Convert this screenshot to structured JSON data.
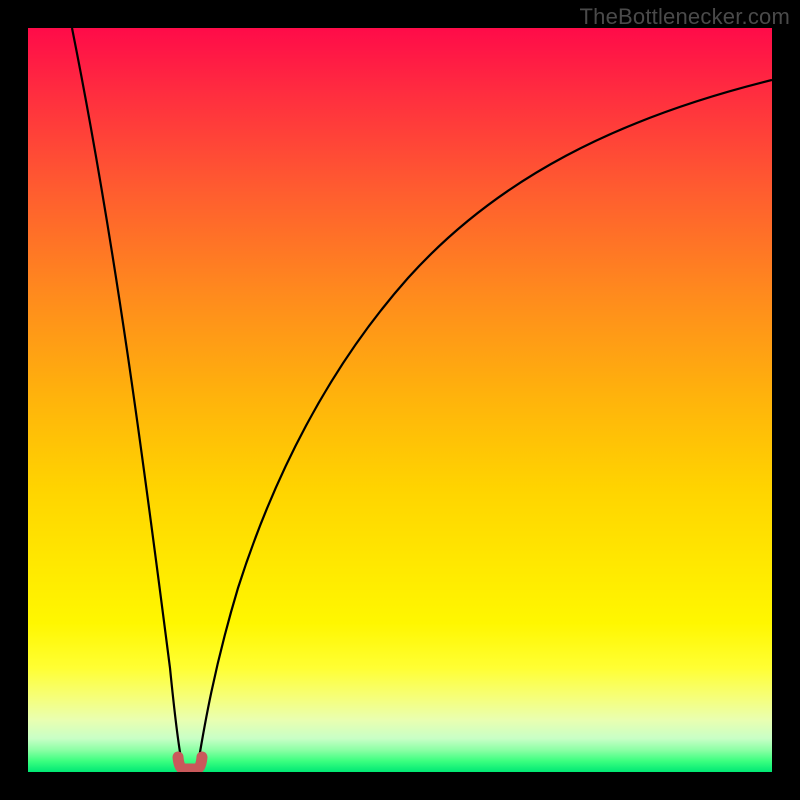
{
  "watermark": {
    "text": "TheBottlenecker.com"
  },
  "chart_data": {
    "type": "line",
    "title": "",
    "xlabel": "",
    "ylabel": "",
    "xlim": [
      0,
      100
    ],
    "ylim": [
      0,
      100
    ],
    "series": [
      {
        "name": "bottleneck-curve",
        "x": [
          0,
          5,
          10,
          15,
          17,
          19,
          20,
          21,
          22,
          23,
          25,
          28,
          32,
          38,
          45,
          55,
          65,
          78,
          90,
          100
        ],
        "y": [
          100,
          76,
          52,
          28,
          17,
          6,
          1,
          0,
          1,
          5,
          17,
          32,
          46,
          58,
          68,
          76,
          82,
          87,
          90.5,
          93
        ]
      }
    ],
    "annotation": {
      "name": "minimum-trough",
      "x_range": [
        19.5,
        22
      ],
      "y": 0.8,
      "color": "#c9595b"
    },
    "gradient_stops": [
      {
        "pos": 0.0,
        "color": "#ff0b49"
      },
      {
        "pos": 0.5,
        "color": "#ffb40b"
      },
      {
        "pos": 0.8,
        "color": "#fff700"
      },
      {
        "pos": 1.0,
        "color": "#00e874"
      }
    ]
  }
}
